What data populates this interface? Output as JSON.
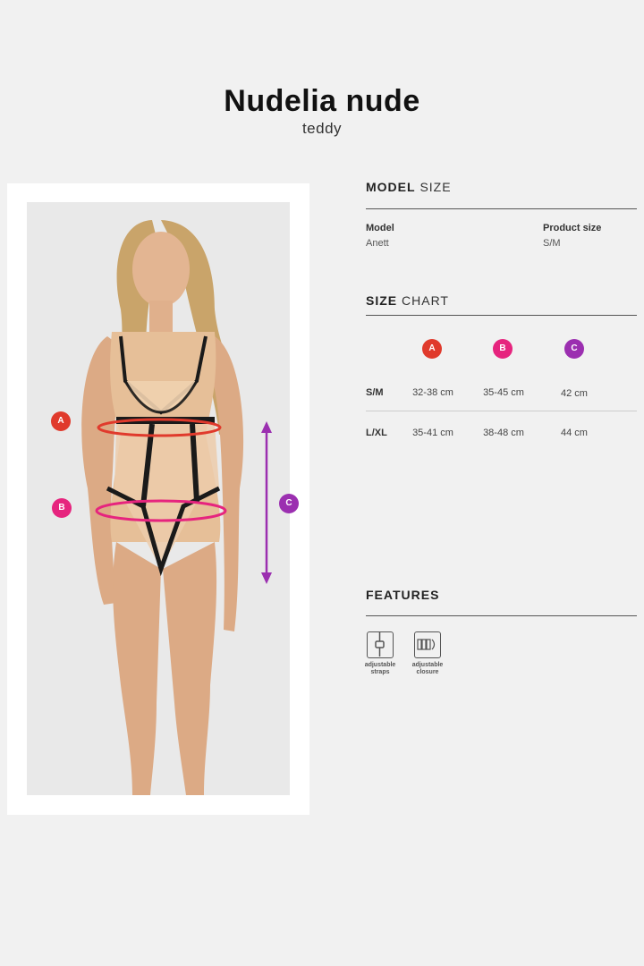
{
  "header": {
    "title": "Nudelia nude",
    "subtitle": "teddy"
  },
  "markers": {
    "a": {
      "label": "A",
      "color": "#e03a2c"
    },
    "b": {
      "label": "B",
      "color": "#e6247e"
    },
    "c": {
      "label": "C",
      "color": "#9b2fb0"
    }
  },
  "model_size": {
    "heading_bold": "MODEL",
    "heading_rest": "SIZE",
    "model_label": "Model",
    "model_value": "Anett",
    "product_size_label": "Product size",
    "product_size_value": "S/M"
  },
  "size_chart": {
    "heading_bold": "SIZE",
    "heading_rest": "CHART",
    "columns": [
      "A",
      "B",
      "C"
    ],
    "rows": [
      {
        "size": "S/M",
        "a": "32-38 cm",
        "b": "35-45 cm",
        "c": "42 cm"
      },
      {
        "size": "L/XL",
        "a": "35-41 cm",
        "b": "38-48 cm",
        "c": "44 cm"
      }
    ]
  },
  "features": {
    "heading": "FEATURES",
    "items": [
      {
        "icon": "adjustable-straps-icon",
        "line1": "adjustable",
        "line2": "straps"
      },
      {
        "icon": "adjustable-closure-icon",
        "line1": "adjustable",
        "line2": "closure"
      }
    ]
  }
}
